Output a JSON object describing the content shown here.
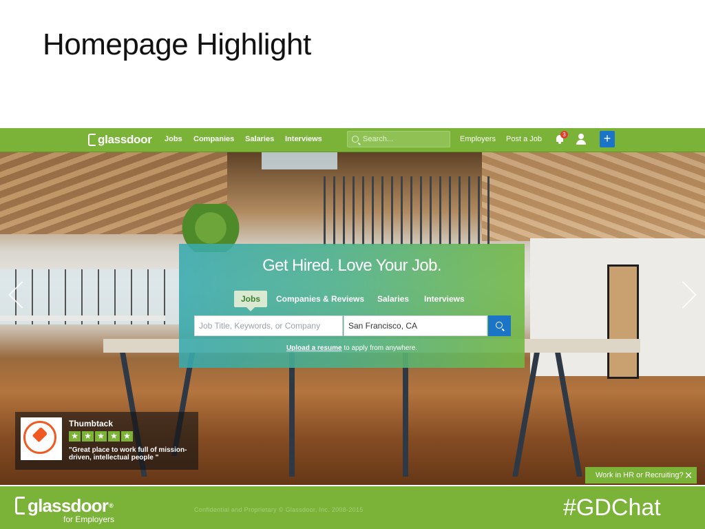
{
  "slide": {
    "title": "Homepage Highlight"
  },
  "nav": {
    "logo": "glassdoor",
    "links": [
      "Jobs",
      "Companies",
      "Salaries",
      "Interviews"
    ],
    "search_placeholder": "Search...",
    "employers": "Employers",
    "post_job": "Post a Job",
    "notification_count": "3",
    "plus_label": "+"
  },
  "hero": {
    "headline": "Get Hired. Love Your Job.",
    "tabs": [
      {
        "label": "Jobs",
        "active": true
      },
      {
        "label": "Companies & Reviews",
        "active": false
      },
      {
        "label": "Salaries",
        "active": false
      },
      {
        "label": "Interviews",
        "active": false
      }
    ],
    "keyword_placeholder": "Job Title, Keywords, or Company",
    "location_value": "San Francisco, CA",
    "upload_link": "Upload a resume",
    "upload_rest": " to apply from anywhere."
  },
  "employer_card": {
    "name": "Thumbtack",
    "stars": 5,
    "star_glyph": "★",
    "quote": "\"Great place to work full of mission-driven, intellectual people \""
  },
  "hr_prompt": {
    "label": "Work in HR or Recruiting?",
    "close": "✕"
  },
  "footer": {
    "logo": "glassdoor",
    "registered": "®",
    "tagline": "for Employers",
    "confidential": "Confidential  and  Proprietary © Glassdoor,  Inc.  2008-2015",
    "hashtag": "#GDChat"
  },
  "colors": {
    "brand_green": "#7ab338",
    "button_blue": "#1b74c6",
    "badge_red": "#e23b2e",
    "thumbtack_orange": "#f05a22"
  },
  "icons": [
    "search-icon",
    "bell-icon",
    "user-icon",
    "plus-icon",
    "chevron-left-icon",
    "chevron-right-icon",
    "pushpin-icon",
    "close-icon"
  ]
}
